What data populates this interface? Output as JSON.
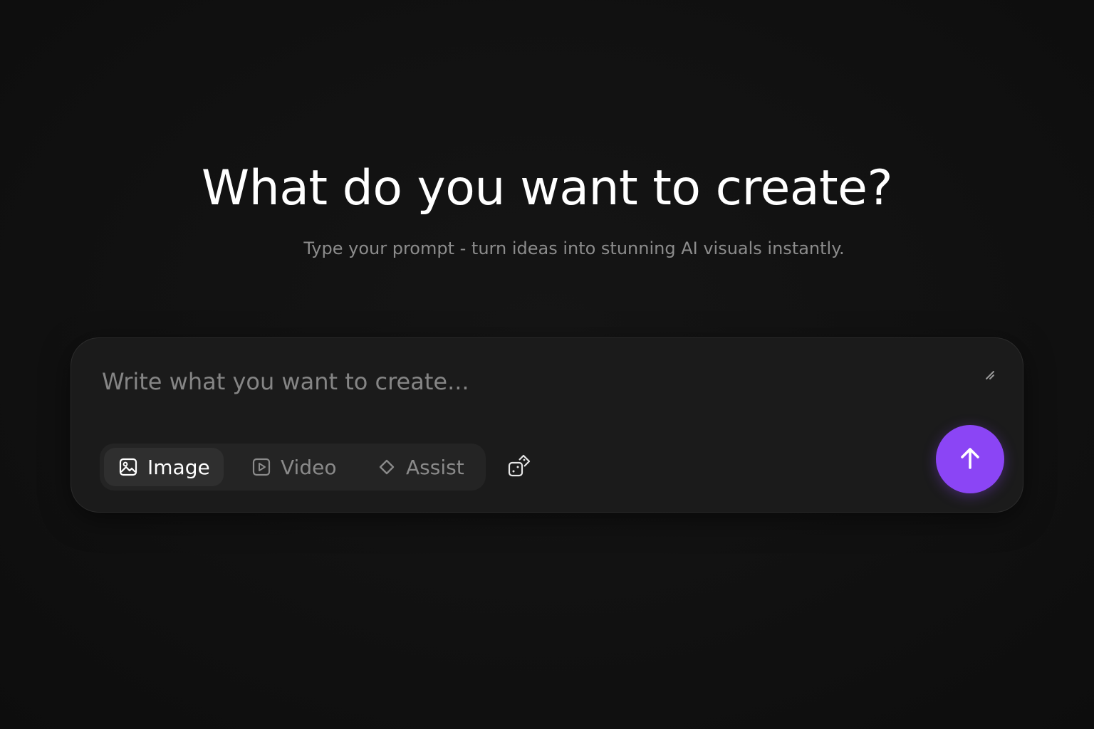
{
  "hero": {
    "title": "What do you want to create?",
    "subtitle": "Type your prompt - turn ideas into stunning AI visuals instantly."
  },
  "composer": {
    "placeholder": "Write what you want to create...",
    "value": "",
    "modes": [
      {
        "label": "Image",
        "icon": "image-icon",
        "active": true
      },
      {
        "label": "Video",
        "icon": "video-icon",
        "active": false
      },
      {
        "label": "Assist",
        "icon": "diamond-icon",
        "active": false
      }
    ],
    "random_icon": "dice-icon",
    "send_icon": "arrow-up-icon",
    "resize_icon": "resize-handle-icon"
  },
  "colors": {
    "background": "#101010",
    "composer_bg": "#1b1b1b",
    "accent": "#8b45f5",
    "active_tab_text": "#ffffff",
    "inactive_tab_text": "#8a8a8a",
    "subtitle_text": "#8c8c8c"
  }
}
